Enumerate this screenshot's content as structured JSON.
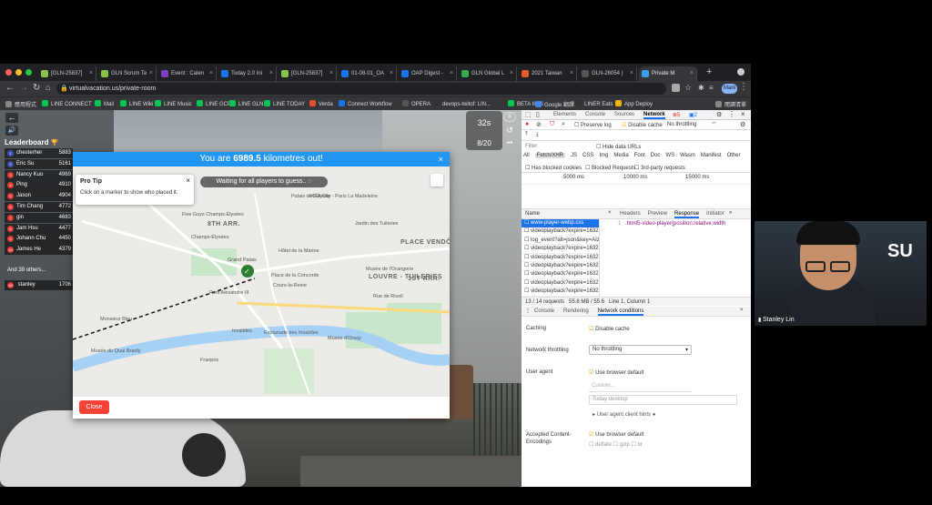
{
  "tabs": [
    {
      "label": "[GLN-25837]",
      "color": "#8bc34a"
    },
    {
      "label": "GLN Scrum Te",
      "color": "#8bc34a"
    },
    {
      "label": "Event : Calen",
      "color": "#7b3fbf"
    },
    {
      "label": "Today 2.0 Ini",
      "color": "#1a73e8"
    },
    {
      "label": "[GLN-25837]",
      "color": "#8bc34a"
    },
    {
      "label": "01-08-01_OA",
      "color": "#1a73e8"
    },
    {
      "label": "OAP Digest -",
      "color": "#1a73e8"
    },
    {
      "label": "GLN Global L",
      "color": "#34a853"
    },
    {
      "label": "2021 Taiwan",
      "color": "#e55b2d"
    },
    {
      "label": "GLN-26054 |",
      "color": "#555"
    },
    {
      "label": "Private M",
      "color": "#3aa0e8",
      "active": true
    }
  ],
  "address": {
    "url": "virtualvacation.us/private-room",
    "profile": "Mark"
  },
  "bookmarks": [
    {
      "label": "應用程式",
      "color": "#888"
    },
    {
      "label": "LINE CONNECT",
      "color": "#06c755"
    },
    {
      "label": "Mail",
      "color": "#06c755"
    },
    {
      "label": "LINE Wiki",
      "color": "#06c755"
    },
    {
      "label": "LINE Music",
      "color": "#06c755"
    },
    {
      "label": "LINE GCP",
      "color": "#06c755"
    },
    {
      "label": "LINE GLN",
      "color": "#06c755"
    },
    {
      "label": "LINE TODAY",
      "color": "#06c755"
    },
    {
      "label": "Verda",
      "color": "#e34f2f"
    },
    {
      "label": "Connect Workflow",
      "color": "#1a73e8"
    },
    {
      "label": "OPERA",
      "color": "#555"
    },
    {
      "label": "devops-twitof: LIN...",
      "color": "#333"
    },
    {
      "label": "BETA IIMS",
      "color": "#06c755"
    },
    {
      "label": "Google 翻譯",
      "color": "#4285f4"
    },
    {
      "label": "LINER Eats",
      "color": "#333"
    },
    {
      "label": "App Deploy",
      "color": "#f4b400"
    },
    {
      "label": "閱讀清單",
      "color": "#888"
    }
  ],
  "game": {
    "timer": "32s",
    "round": "8/20",
    "leaderboard_title": "Leaderboard",
    "players": [
      {
        "rank": "1",
        "name": "chesterher",
        "score": "5883",
        "color": "#3f51b5"
      },
      {
        "rank": "2",
        "name": "Eric Su",
        "score": "5161",
        "color": "#3f51b5"
      },
      {
        "rank": "3",
        "name": "Nancy Kuo",
        "score": "4969",
        "color": "#e53935"
      },
      {
        "rank": "4",
        "name": "Ping",
        "score": "4910",
        "color": "#e53935"
      },
      {
        "rank": "5",
        "name": "Jason",
        "score": "4904",
        "color": "#e53935"
      },
      {
        "rank": "6",
        "name": "Tim Chang",
        "score": "4772",
        "color": "#e53935"
      },
      {
        "rank": "7",
        "name": "gin",
        "score": "4683",
        "color": "#e53935"
      },
      {
        "rank": "8",
        "name": "Jam Hsu",
        "score": "4477",
        "color": "#e53935"
      },
      {
        "rank": "9",
        "name": "Johann Chu",
        "score": "4450",
        "color": "#e53935"
      },
      {
        "rank": "10",
        "name": "James He",
        "score": "4379",
        "color": "#e53935"
      }
    ],
    "others": "And 39 others...",
    "self": {
      "rank": "48",
      "name": "stanley",
      "score": "1706"
    },
    "modal": {
      "title_pre": "You are ",
      "title_value": "6989.5",
      "title_post": " kilometres out!",
      "waiting": "Waiting for all players to guess..",
      "tip_title": "Pro Tip",
      "tip_text": "Click on a marker to show who placed it.",
      "close": "Close",
      "accent": "#2196f3",
      "close_color": "#f44336"
    },
    "map_labels": [
      "8TH ARR.",
      "PLACE VENDÔME",
      "1ST ARR.",
      "LOUVRE - TUILERIES",
      "Grand Palais",
      "Place de la Concorde",
      "Jardin des Tuileries",
      "Musée de l'Orangerie",
      "Hôtel de la Marine",
      "IKEA City - Paris La Madeleine",
      "Five Guys Champs-Élysées",
      "Palais de l'Élysée",
      "Pont Alexandre III",
      "Invalides",
      "Esplanade des Invalides",
      "Musée d'Orsay",
      "Ladurée",
      "Franprix",
      "Monsieur Bleu",
      "Cours-la-Reine",
      "Rue de Rivoli",
      "Palais de l'Élysée",
      "Musée du Quai Branly",
      "Arc de Triomphe",
      "Champs-Élysées"
    ]
  },
  "devtools": {
    "tabs": [
      "Elements",
      "Console",
      "Sources",
      "Network"
    ],
    "errors": "5",
    "warnings": "2",
    "preserve": "Preserve log",
    "disable_cache": "Disable cache",
    "throttle": "No throttling",
    "filter": "Filter",
    "hide_data": "Hide data URLs",
    "types": [
      "All",
      "Fetch/XHR",
      "JS",
      "CSS",
      "Img",
      "Media",
      "Font",
      "Doc",
      "WS",
      "Wasm",
      "Manifest",
      "Other"
    ],
    "has_blocked": "Has blocked cookies",
    "blocked_req": "Blocked Requests",
    "third_party": "3rd-party requests",
    "timeline": [
      "5000 ms",
      "10000 ms",
      "15000 ms"
    ],
    "name_col": "Name",
    "detail_tabs": [
      "Headers",
      "Preview",
      "Response",
      "Initiator"
    ],
    "requests": [
      "www-player-webp.css",
      "videoplayback?expire=1632...",
      "log_event?alt=json&key=AIz...",
      "videoplayback?expire=1632...",
      "videoplayback?expire=1632...",
      "videoplayback?expire=1632...",
      "videoplayback?expire=1632...",
      "videoplayback?expire=1632...",
      "videoplayback?expire=1632..."
    ],
    "code_line": "1",
    "code": ".html5-video-player{position:relative;width",
    "summary": "13 / 14 requests",
    "size": "55.6 MB / 55.6",
    "pos": "Line 1, Column 1",
    "drawer_tabs": [
      "Console",
      "Rendering",
      "Network conditions"
    ],
    "caching": "Caching",
    "caching_val": "Disable cache",
    "throttling": "Network throttling",
    "throttling_val": "No throttling",
    "user_agent": "User agent",
    "ua_default": "Use browser default",
    "ua_custom": "Custom...",
    "ua_placeholder": "Enter a custom user agent",
    "ua_text": "Today desktop",
    "ua_hints": "User agent client hints",
    "encodings": "Accepted Content-Encodings",
    "enc_default": "Use browser default",
    "enc_list": [
      "deflate",
      "gzip",
      "br"
    ]
  },
  "video": {
    "name": "Stanley Lin",
    "overlay": "SU"
  }
}
